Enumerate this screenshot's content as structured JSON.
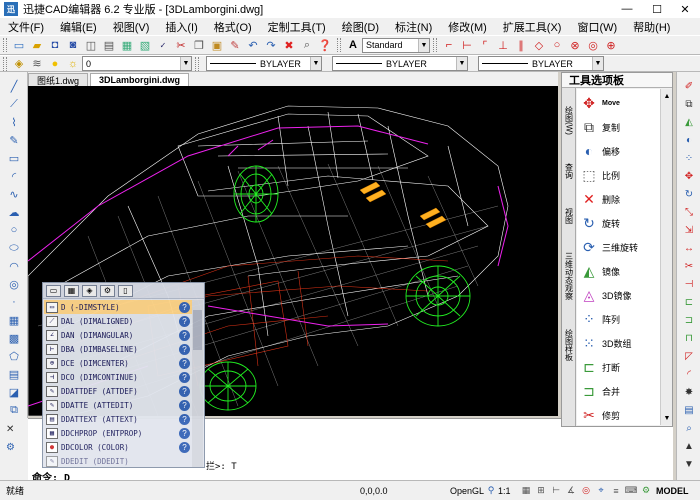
{
  "window": {
    "logo": "迅",
    "title": "迅捷CAD编辑器 6.2 专业版 - [3DLamborgini.dwg]",
    "minimize": "—",
    "maximize": "☐",
    "close": "✕"
  },
  "menu": [
    "文件(F)",
    "编辑(E)",
    "视图(V)",
    "插入(I)",
    "格式(O)",
    "定制工具(T)",
    "绘图(D)",
    "标注(N)",
    "修改(M)",
    "扩展工具(X)",
    "窗口(W)",
    "帮助(H)"
  ],
  "toolbar": {
    "textstyle": "Standard",
    "layer": "0",
    "linetype": "BYLAYER",
    "lineweight": "BYLAYER",
    "color": "BYLAYER"
  },
  "tabs": [
    {
      "label": "图纸1.dwg"
    },
    {
      "label": "3DLamborgini.dwg"
    }
  ],
  "palette": {
    "title": "工具选项板",
    "vtabs": [
      "绘图(W)",
      "查询",
      "视图",
      "三维动态观察",
      "绘图样板"
    ],
    "items": [
      {
        "label": "Move",
        "icon": "move-icon"
      },
      {
        "label": "复制",
        "icon": "copy-icon"
      },
      {
        "label": "偏移",
        "icon": "offset-icon"
      },
      {
        "label": "比例",
        "icon": "scale-icon"
      },
      {
        "label": "删除",
        "icon": "delete-icon"
      },
      {
        "label": "旋转",
        "icon": "rotate-icon"
      },
      {
        "label": "三维旋转",
        "icon": "rotate3d-icon"
      },
      {
        "label": "镜像",
        "icon": "mirror-icon"
      },
      {
        "label": "3D镜像",
        "icon": "mirror3d-icon"
      },
      {
        "label": "阵列",
        "icon": "array-icon"
      },
      {
        "label": "3D数组",
        "icon": "array3d-icon"
      },
      {
        "label": "打断",
        "icon": "break-icon"
      },
      {
        "label": "合并",
        "icon": "join-icon"
      },
      {
        "label": "修剪",
        "icon": "trim-icon"
      }
    ]
  },
  "autocomplete": {
    "rows": [
      "D (-DIMSTYLE)",
      "DAL (DIMALIGNED)",
      "DAN (DIMANGULAR)",
      "DBA (DIMBASELINE)",
      "DCE (DIMCENTER)",
      "DCO (DIMCONTINUE)",
      "DDATTDEF (ATTDEF)",
      "DDATTE (ATTEDIT)",
      "DDATTEXT (ATTEXT)",
      "DDCHPROP (ENTPROP)",
      "DDCOLOR (COLOR)",
      "DDEDIT (DDEDIT)"
    ]
  },
  "command": {
    "history": "拦>: T",
    "prompt": "命令:  D"
  },
  "status": {
    "ready": "就绪",
    "coords": "0,0,0.0",
    "opengl": "OpenGL",
    "scale": "1:1",
    "model": "MODEL"
  },
  "colors": {
    "wireframe": "#ffffff",
    "wheels": "#22ee22",
    "accent_orange": "#ffb020",
    "outline_magenta": "#ee22ee",
    "detail_red": "#ff3a1a",
    "selection": "#ffd68a"
  }
}
